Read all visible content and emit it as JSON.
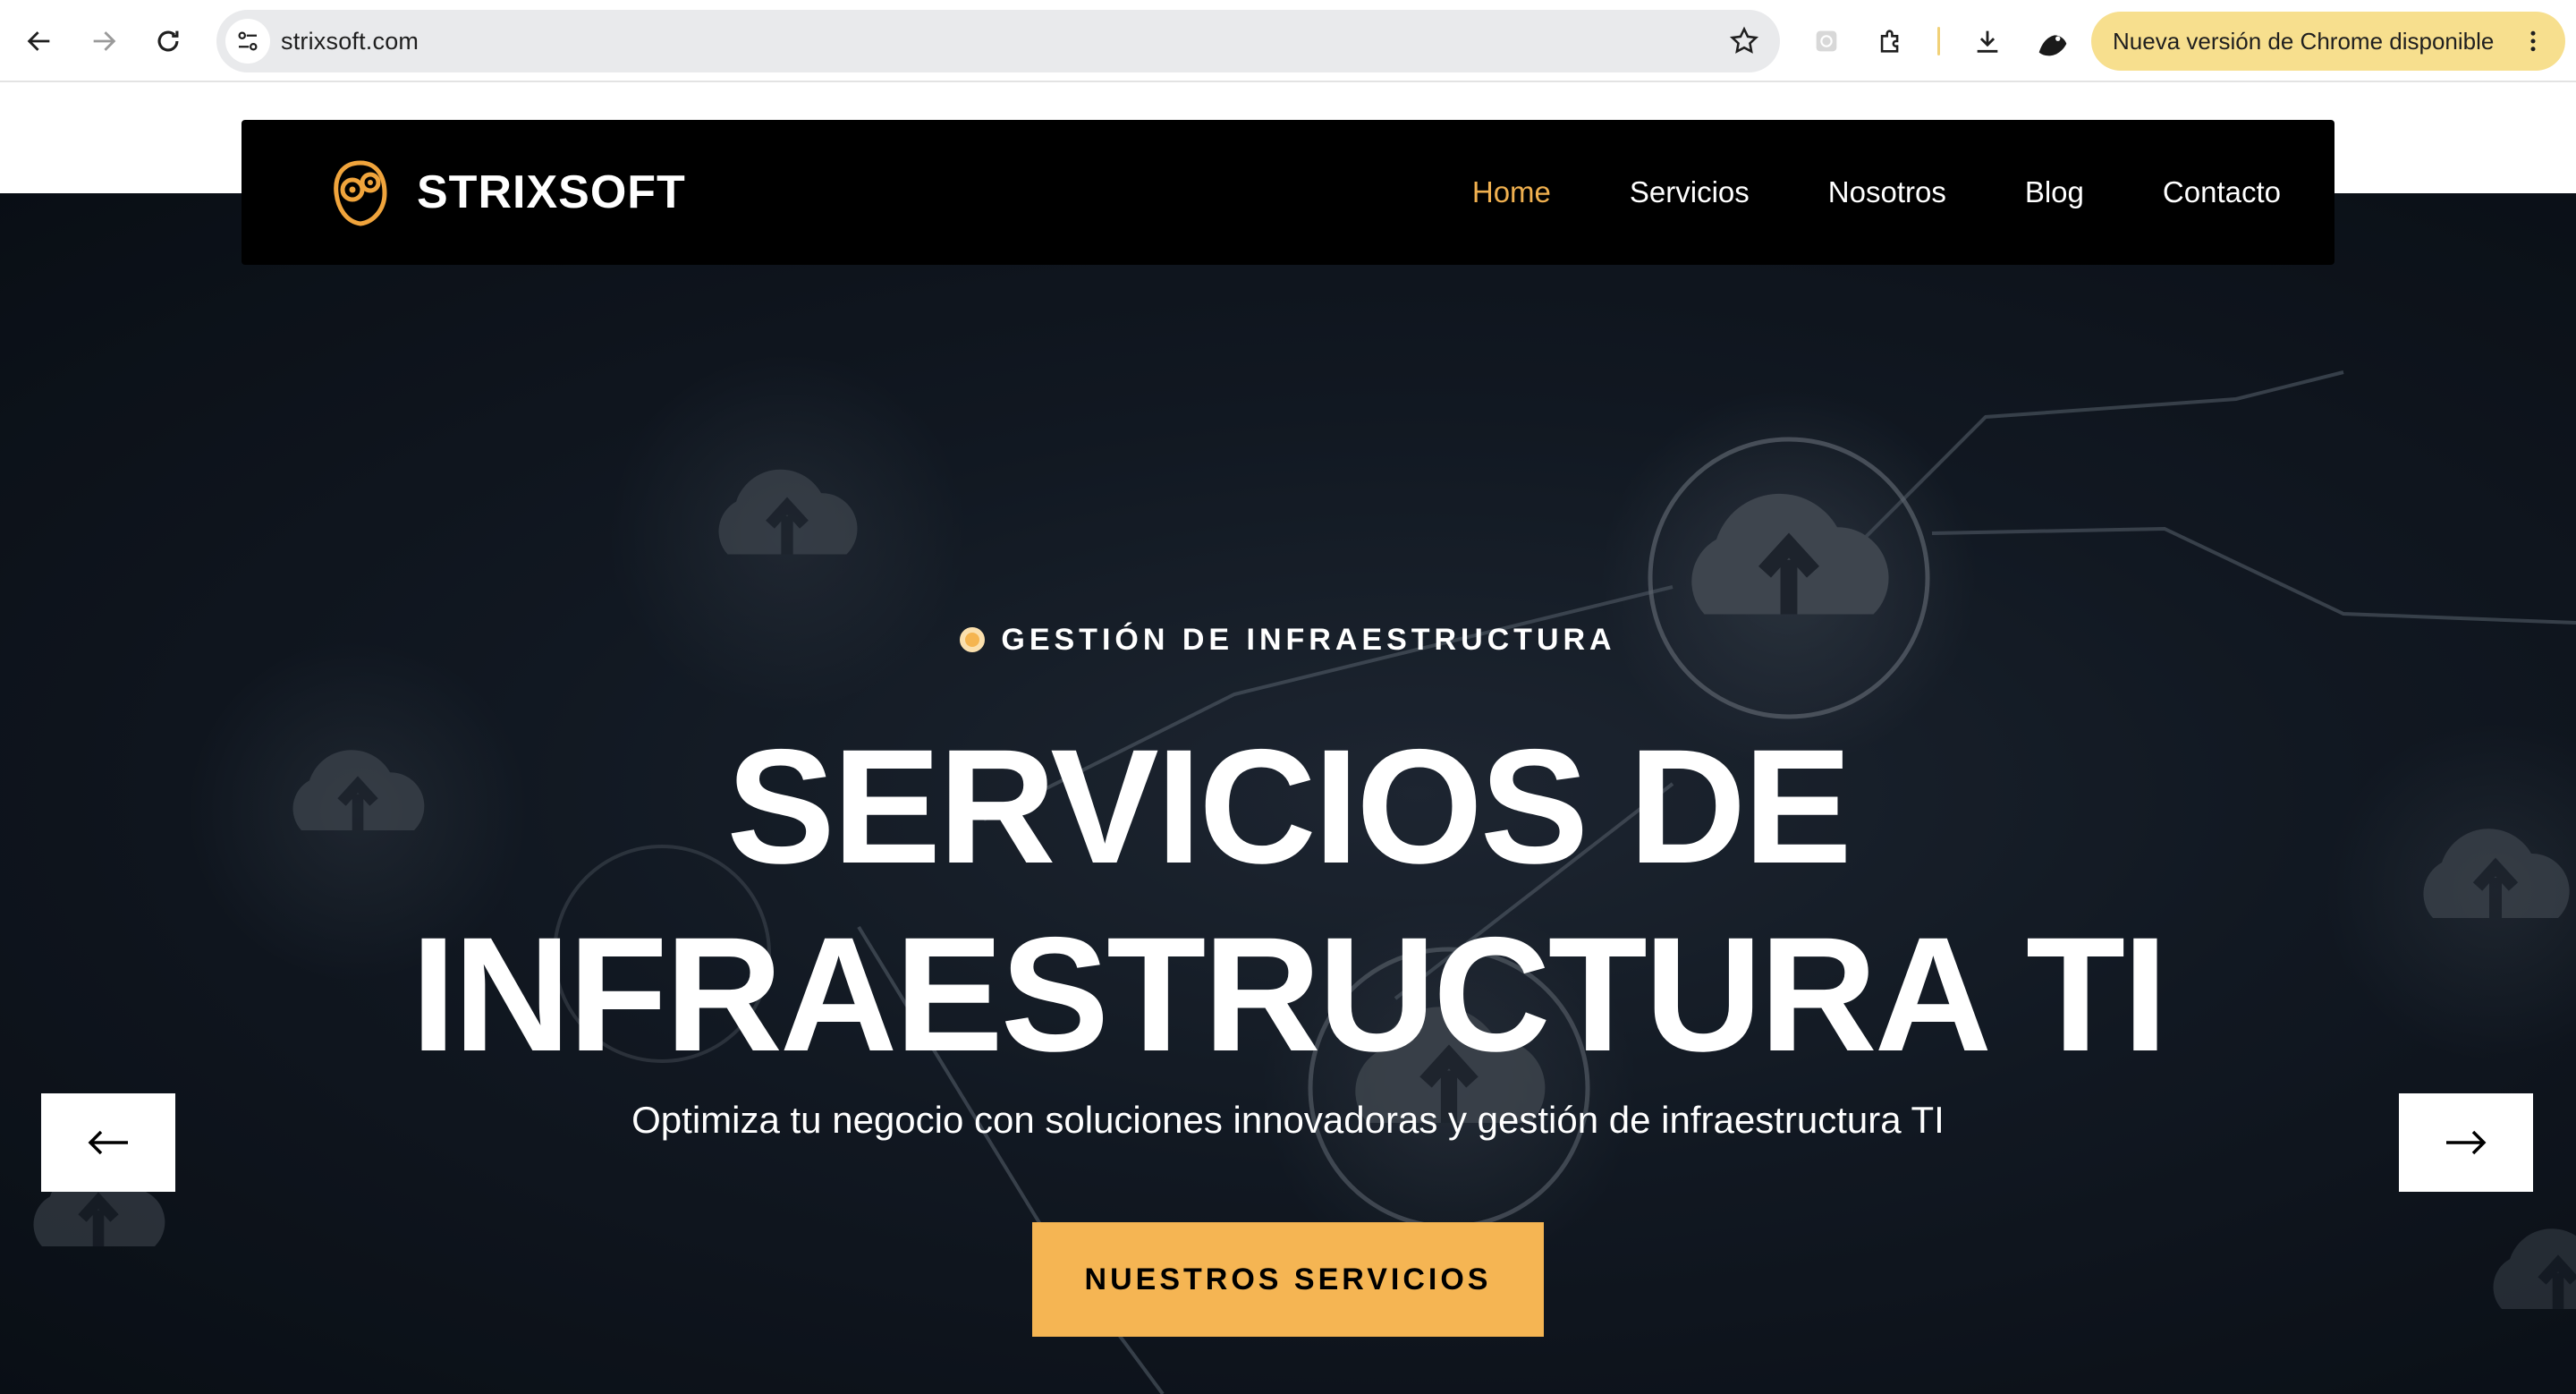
{
  "browser": {
    "url": "strixsoft.com",
    "update_label": "Nueva versión de Chrome disponible"
  },
  "site": {
    "brand": "STRIXSOFT",
    "nav": [
      "Home",
      "Servicios",
      "Nosotros",
      "Blog",
      "Contacto"
    ],
    "active_nav": "Home",
    "accent_color": "#f5b553"
  },
  "hero": {
    "eyebrow": "GESTIÓN DE INFRAESTRUCTURA",
    "headline_line1": "SERVICIOS DE",
    "headline_line2": "INFRAESTRUCTURA TI",
    "subtitle": "Optimiza tu negocio con soluciones innovadoras y gestión de infraestructura TI",
    "cta": "NUESTROS SERVICIOS",
    "prev_icon": "arrow-left-icon",
    "next_icon": "arrow-right-icon"
  }
}
